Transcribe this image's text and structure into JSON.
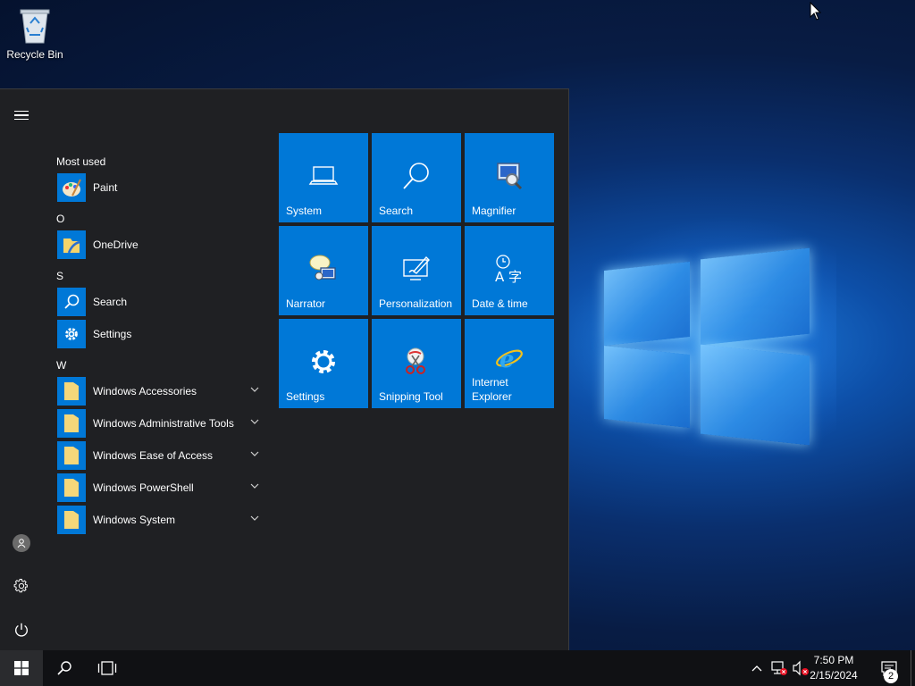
{
  "desktop": {
    "recycle_bin_label": "Recycle Bin"
  },
  "start_menu": {
    "app_list": {
      "most_used_header": "Most used",
      "most_used": [
        {
          "label": "Paint",
          "icon": "paint-icon"
        }
      ],
      "groups": [
        {
          "letter": "O",
          "items": [
            {
              "label": "OneDrive",
              "icon": "onedrive-icon"
            }
          ]
        },
        {
          "letter": "S",
          "items": [
            {
              "label": "Search",
              "icon": "search-icon"
            },
            {
              "label": "Settings",
              "icon": "gear-icon"
            }
          ]
        },
        {
          "letter": "W",
          "items": [
            {
              "label": "Windows Accessories",
              "icon": "folder-icon",
              "expandable": true
            },
            {
              "label": "Windows Administrative Tools",
              "icon": "folder-icon",
              "expandable": true
            },
            {
              "label": "Windows Ease of Access",
              "icon": "folder-icon",
              "expandable": true
            },
            {
              "label": "Windows PowerShell",
              "icon": "folder-icon",
              "expandable": true
            },
            {
              "label": "Windows System",
              "icon": "folder-icon",
              "expandable": true
            }
          ]
        }
      ]
    },
    "tiles": [
      {
        "label": "System",
        "icon": "laptop-icon"
      },
      {
        "label": "Search",
        "icon": "search-icon"
      },
      {
        "label": "Magnifier",
        "icon": "magnifier-icon"
      },
      {
        "label": "Narrator",
        "icon": "narrator-icon"
      },
      {
        "label": "Personalization",
        "icon": "personalization-icon"
      },
      {
        "label": "Date & time",
        "icon": "date-time-icon"
      },
      {
        "label": "Settings",
        "icon": "gear-icon"
      },
      {
        "label": "Snipping Tool",
        "icon": "scissors-icon"
      },
      {
        "label": "Internet Explorer",
        "icon": "internet-explorer-icon"
      }
    ],
    "rail": {
      "menu_icon": "hamburger-icon",
      "user_icon": "user-icon",
      "settings_icon": "gear-icon",
      "power_icon": "power-icon"
    }
  },
  "taskbar": {
    "time": "7:50 PM",
    "date": "2/15/2024",
    "notification_count": "2",
    "tray_icons": [
      "chevron-up-icon",
      "network-icon",
      "volume-muted-icon"
    ]
  },
  "colors": {
    "accent": "#0078d7",
    "menu_bg": "#1f2023",
    "taskbar_bg": "#101114"
  }
}
